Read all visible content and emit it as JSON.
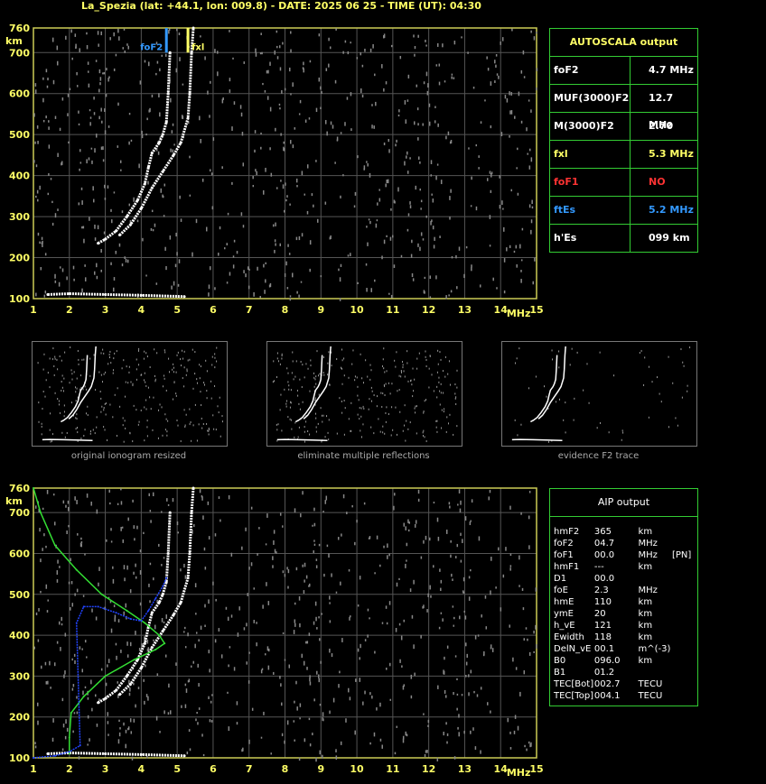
{
  "header": {
    "title": "La_Spezia (lat: +44.1, lon: 009.8) - DATE: 2025 06 25 - TIME (UT): 04:30"
  },
  "autoscala": {
    "title": "AUTOSCALA output",
    "rows": [
      {
        "key": "foF2",
        "value": "4.7 MHz",
        "color": "#ffffff"
      },
      {
        "key": "MUF(3000)F2",
        "value": "12.7 MHz",
        "color": "#ffffff"
      },
      {
        "key": "M(3000)F2",
        "value": "2.70",
        "color": "#ffffff"
      },
      {
        "key": "fxl",
        "value": "5.3 MHz",
        "color": "#ffff66"
      },
      {
        "key": "foF1",
        "value": "NO",
        "color": "#ff3333"
      },
      {
        "key": "ftEs",
        "value": "5.2 MHz",
        "color": "#3399ff"
      },
      {
        "key": "h'Es",
        "value": "099     km",
        "color": "#ffffff"
      }
    ]
  },
  "aip": {
    "title": "AIP output",
    "rows": [
      [
        "hmF2",
        "365",
        "km",
        ""
      ],
      [
        "foF2",
        "04.7",
        "MHz",
        ""
      ],
      [
        "foF1",
        "00.0",
        "MHz",
        "[PN]"
      ],
      [
        "hmF1",
        "---",
        "km",
        ""
      ],
      [
        "D1",
        "00.0",
        "",
        ""
      ],
      [
        "foE",
        "2.3",
        "MHz",
        ""
      ],
      [
        "hmE",
        "110",
        "km",
        ""
      ],
      [
        "ymE",
        "20",
        "km",
        ""
      ],
      [
        "h_vE",
        "121",
        "km",
        ""
      ],
      [
        "Ewidth",
        "118",
        "km",
        ""
      ],
      [
        "DelN_vE",
        "00.1",
        "m^(-3)",
        ""
      ],
      [
        "B0",
        "096.0",
        "km",
        ""
      ],
      [
        "B1",
        "01.2",
        "",
        ""
      ],
      [
        "TEC[Bot]",
        "002.7",
        "TECU",
        ""
      ],
      [
        "TEC[Top]",
        "004.1",
        "TECU",
        ""
      ]
    ]
  },
  "thumbnails": {
    "captions": [
      "original ionogram resized",
      "eliminate multiple reflections",
      "evidence F2 trace"
    ]
  },
  "chart_data": [
    {
      "type": "scatter",
      "title": "",
      "xlabel": "MHz",
      "ylabel": "km",
      "xlim": [
        1,
        15
      ],
      "ylim": [
        100,
        760
      ],
      "xticks": [
        1,
        2,
        3,
        4,
        5,
        6,
        7,
        8,
        9,
        10,
        11,
        12,
        13,
        14,
        15
      ],
      "yticks": [
        100,
        200,
        300,
        400,
        500,
        600,
        700,
        760
      ],
      "grid": true,
      "markers": [
        {
          "name": "foF2",
          "x": 4.7,
          "color": "#3399ff"
        },
        {
          "name": "fxl",
          "x": 5.3,
          "color": "#ffff66"
        }
      ],
      "series": [
        {
          "name": "O-trace",
          "color": "#ffffff",
          "points": [
            [
              2.8,
              235
            ],
            [
              3.0,
              245
            ],
            [
              3.3,
              265
            ],
            [
              3.6,
              300
            ],
            [
              3.9,
              340
            ],
            [
              4.1,
              380
            ],
            [
              4.2,
              420
            ],
            [
              4.3,
              455
            ],
            [
              4.5,
              480
            ],
            [
              4.6,
              500
            ],
            [
              4.7,
              530
            ],
            [
              4.75,
              600
            ],
            [
              4.8,
              700
            ]
          ]
        },
        {
          "name": "X-trace",
          "color": "#ffffff",
          "points": [
            [
              3.4,
              255
            ],
            [
              3.7,
              280
            ],
            [
              4.0,
              320
            ],
            [
              4.3,
              370
            ],
            [
              4.6,
              410
            ],
            [
              4.9,
              450
            ],
            [
              5.1,
              480
            ],
            [
              5.3,
              540
            ],
            [
              5.35,
              600
            ],
            [
              5.4,
              700
            ],
            [
              5.45,
              760
            ]
          ]
        },
        {
          "name": "Es-trace",
          "color": "#ffffff",
          "points": [
            [
              1.4,
              110
            ],
            [
              2.0,
              112
            ],
            [
              3.0,
              110
            ],
            [
              4.0,
              108
            ],
            [
              5.2,
              105
            ]
          ]
        }
      ]
    },
    {
      "type": "scatter",
      "title": "",
      "xlabel": "MHz",
      "ylabel": "km",
      "xlim": [
        1,
        15
      ],
      "ylim": [
        100,
        760
      ],
      "xticks": [
        1,
        2,
        3,
        4,
        5,
        6,
        7,
        8,
        9,
        10,
        11,
        12,
        13,
        14,
        15
      ],
      "yticks": [
        100,
        200,
        300,
        400,
        500,
        600,
        700,
        760
      ],
      "grid": true,
      "series": [
        {
          "name": "O-trace",
          "color": "#ffffff",
          "points": [
            [
              2.8,
              235
            ],
            [
              3.0,
              245
            ],
            [
              3.3,
              265
            ],
            [
              3.6,
              300
            ],
            [
              3.9,
              340
            ],
            [
              4.1,
              380
            ],
            [
              4.2,
              420
            ],
            [
              4.3,
              455
            ],
            [
              4.5,
              480
            ],
            [
              4.6,
              500
            ],
            [
              4.7,
              530
            ],
            [
              4.75,
              600
            ],
            [
              4.8,
              700
            ]
          ]
        },
        {
          "name": "X-trace",
          "color": "#ffffff",
          "points": [
            [
              3.4,
              255
            ],
            [
              3.7,
              280
            ],
            [
              4.0,
              320
            ],
            [
              4.3,
              370
            ],
            [
              4.6,
              410
            ],
            [
              4.9,
              450
            ],
            [
              5.1,
              480
            ],
            [
              5.3,
              540
            ],
            [
              5.35,
              600
            ],
            [
              5.4,
              700
            ],
            [
              5.45,
              760
            ]
          ]
        },
        {
          "name": "Es-trace",
          "color": "#ffffff",
          "points": [
            [
              1.4,
              110
            ],
            [
              2.0,
              112
            ],
            [
              3.0,
              110
            ],
            [
              4.0,
              108
            ],
            [
              5.2,
              105
            ]
          ]
        },
        {
          "name": "profile",
          "color": "#33dd33",
          "points": [
            [
              1.0,
              760
            ],
            [
              1.2,
              700
            ],
            [
              1.6,
              620
            ],
            [
              2.2,
              560
            ],
            [
              2.9,
              500
            ],
            [
              3.6,
              460
            ],
            [
              4.1,
              430
            ],
            [
              4.5,
              400
            ],
            [
              4.65,
              380
            ],
            [
              4.4,
              365
            ],
            [
              3.8,
              340
            ],
            [
              3.0,
              300
            ],
            [
              2.4,
              250
            ],
            [
              2.05,
              210
            ],
            [
              2.0,
              150
            ],
            [
              2.0,
              110
            ]
          ]
        },
        {
          "name": "virtual",
          "color": "#2244ff",
          "points": [
            [
              1.0,
              100
            ],
            [
              1.6,
              105
            ],
            [
              2.0,
              115
            ],
            [
              2.3,
              130
            ],
            [
              2.2,
              430
            ],
            [
              2.4,
              470
            ],
            [
              2.8,
              470
            ],
            [
              3.3,
              455
            ],
            [
              3.7,
              440
            ],
            [
              4.0,
              435
            ],
            [
              4.2,
              460
            ],
            [
              4.4,
              490
            ],
            [
              4.6,
              520
            ],
            [
              4.7,
              540
            ]
          ]
        }
      ]
    }
  ]
}
